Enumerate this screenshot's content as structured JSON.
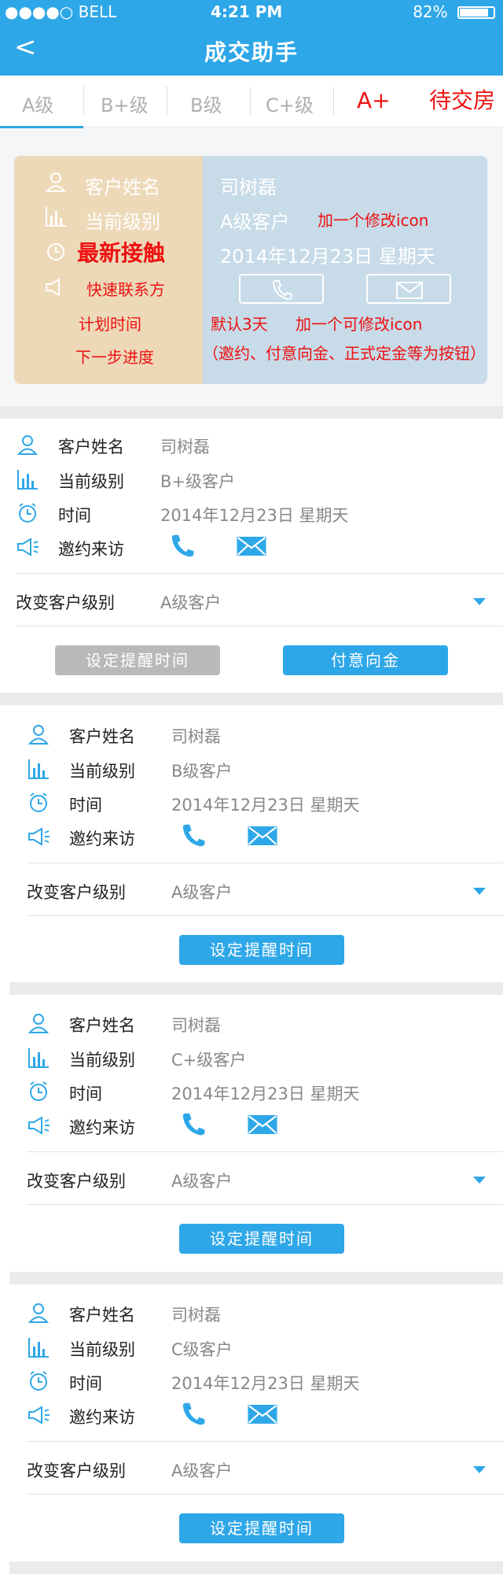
{
  "status": {
    "carrier": "●●●●○ BELL",
    "time": "4:21 PM",
    "battery": "82%"
  },
  "nav": {
    "back": "<",
    "title": "成交助手"
  },
  "tabs": [
    "A级",
    "B+级",
    "B级",
    "C+级",
    "A+",
    "待交房"
  ],
  "mock": {
    "labels": [
      "客户姓名",
      "当前级别",
      "最新接触",
      "快速联系方"
    ],
    "values": [
      "司树磊",
      "A级客户",
      "2014年12月23日  星期天"
    ],
    "notes": {
      "edit_icon": "加一个修改icon",
      "plan_time": "计划时间",
      "default3": "默认3天",
      "edit_icon2": "加一个可修改icon",
      "next_step": "下一步进度",
      "buttons_note": "（邀约、付意向金、正式定金等为按钮）"
    }
  },
  "cards": [
    {
      "name_label": "客户姓名",
      "name": "司树磊",
      "level_label": "当前级别",
      "level": "B+级客户",
      "time_label": "时间",
      "time": "2014年12月23日  星期天",
      "visit_label": "邀约来访",
      "change_label": "改变客户级别",
      "change_value": "A级客户",
      "buttons": [
        "设定提醒时间",
        "付意向金"
      ]
    },
    {
      "name_label": "客户姓名",
      "name": "司树磊",
      "level_label": "当前级别",
      "level": "B级客户",
      "time_label": "时间",
      "time": "2014年12月23日  星期天",
      "visit_label": "邀约来访",
      "change_label": "改变客户级别",
      "change_value": "A级客户",
      "buttons": [
        "设定提醒时间"
      ]
    },
    {
      "name_label": "客户姓名",
      "name": "司树磊",
      "level_label": "当前级别",
      "level": "C+级客户",
      "time_label": "时间",
      "time": "2014年12月23日  星期天",
      "visit_label": "邀约来访",
      "change_label": "改变客户级别",
      "change_value": "A级客户",
      "buttons": [
        "设定提醒时间"
      ]
    },
    {
      "name_label": "客户姓名",
      "name": "司树磊",
      "level_label": "当前级别",
      "level": "C级客户",
      "time_label": "时间",
      "time": "2014年12月23日  星期天",
      "visit_label": "邀约来访",
      "change_label": "改变客户级别",
      "change_value": "A级客户",
      "buttons": [
        "设定提醒时间"
      ]
    }
  ],
  "colors": {
    "accent": "#2ea7e8",
    "note_red": "#ee1111",
    "gray_button": "#b9b9b9"
  }
}
